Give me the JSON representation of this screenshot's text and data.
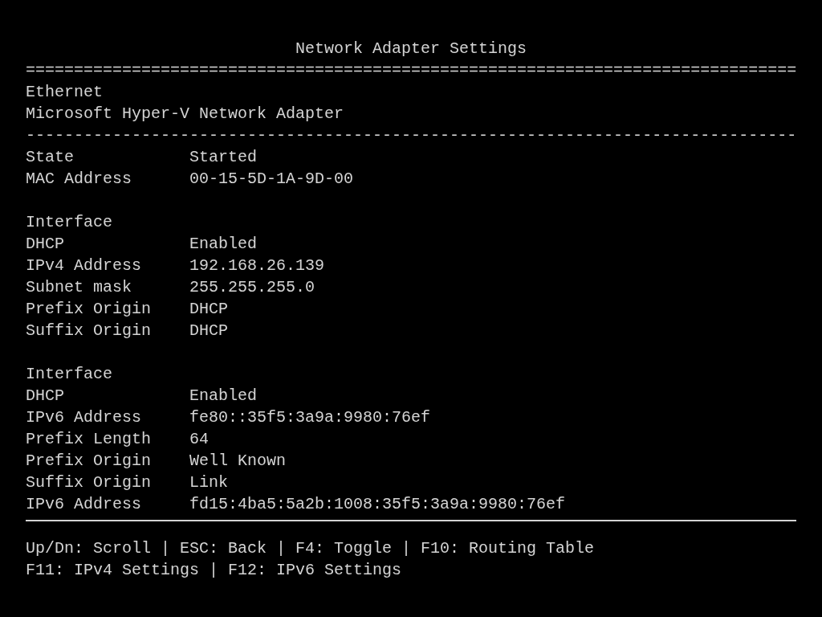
{
  "title": "Network Adapter Settings",
  "title_rule": "================================================================================",
  "adapter": {
    "name": "Ethernet",
    "description": "Microsoft Hyper-V Network Adapter"
  },
  "section_rule": "--------------------------------------------------------------------------------",
  "groups": [
    {
      "rows": [
        {
          "label": "State",
          "value": "Started"
        },
        {
          "label": "MAC Address",
          "value": "00-15-5D-1A-9D-00"
        }
      ]
    },
    {
      "heading": "Interface",
      "rows": [
        {
          "label": "DHCP",
          "value": "Enabled"
        },
        {
          "label": "IPv4 Address",
          "value": "192.168.26.139"
        },
        {
          "label": "Subnet mask",
          "value": "255.255.255.0"
        },
        {
          "label": "Prefix Origin",
          "value": "DHCP"
        },
        {
          "label": "Suffix Origin",
          "value": "DHCP"
        }
      ]
    },
    {
      "heading": "Interface",
      "rows": [
        {
          "label": "DHCP",
          "value": "Enabled"
        },
        {
          "label": "IPv6 Address",
          "value": "fe80::35f5:3a9a:9980:76ef"
        },
        {
          "label": "Prefix Length",
          "value": "64"
        },
        {
          "label": "Prefix Origin",
          "value": "Well Known"
        },
        {
          "label": "Suffix Origin",
          "value": "Link"
        },
        {
          "label": "IPv6 Address",
          "value": "fd15:4ba5:5a2b:1008:35f5:3a9a:9980:76ef"
        }
      ]
    }
  ],
  "footer_lines": [
    "Up/Dn: Scroll | ESC: Back | F4: Toggle | F10: Routing Table",
    "F11: IPv4 Settings | F12: IPv6 Settings"
  ]
}
